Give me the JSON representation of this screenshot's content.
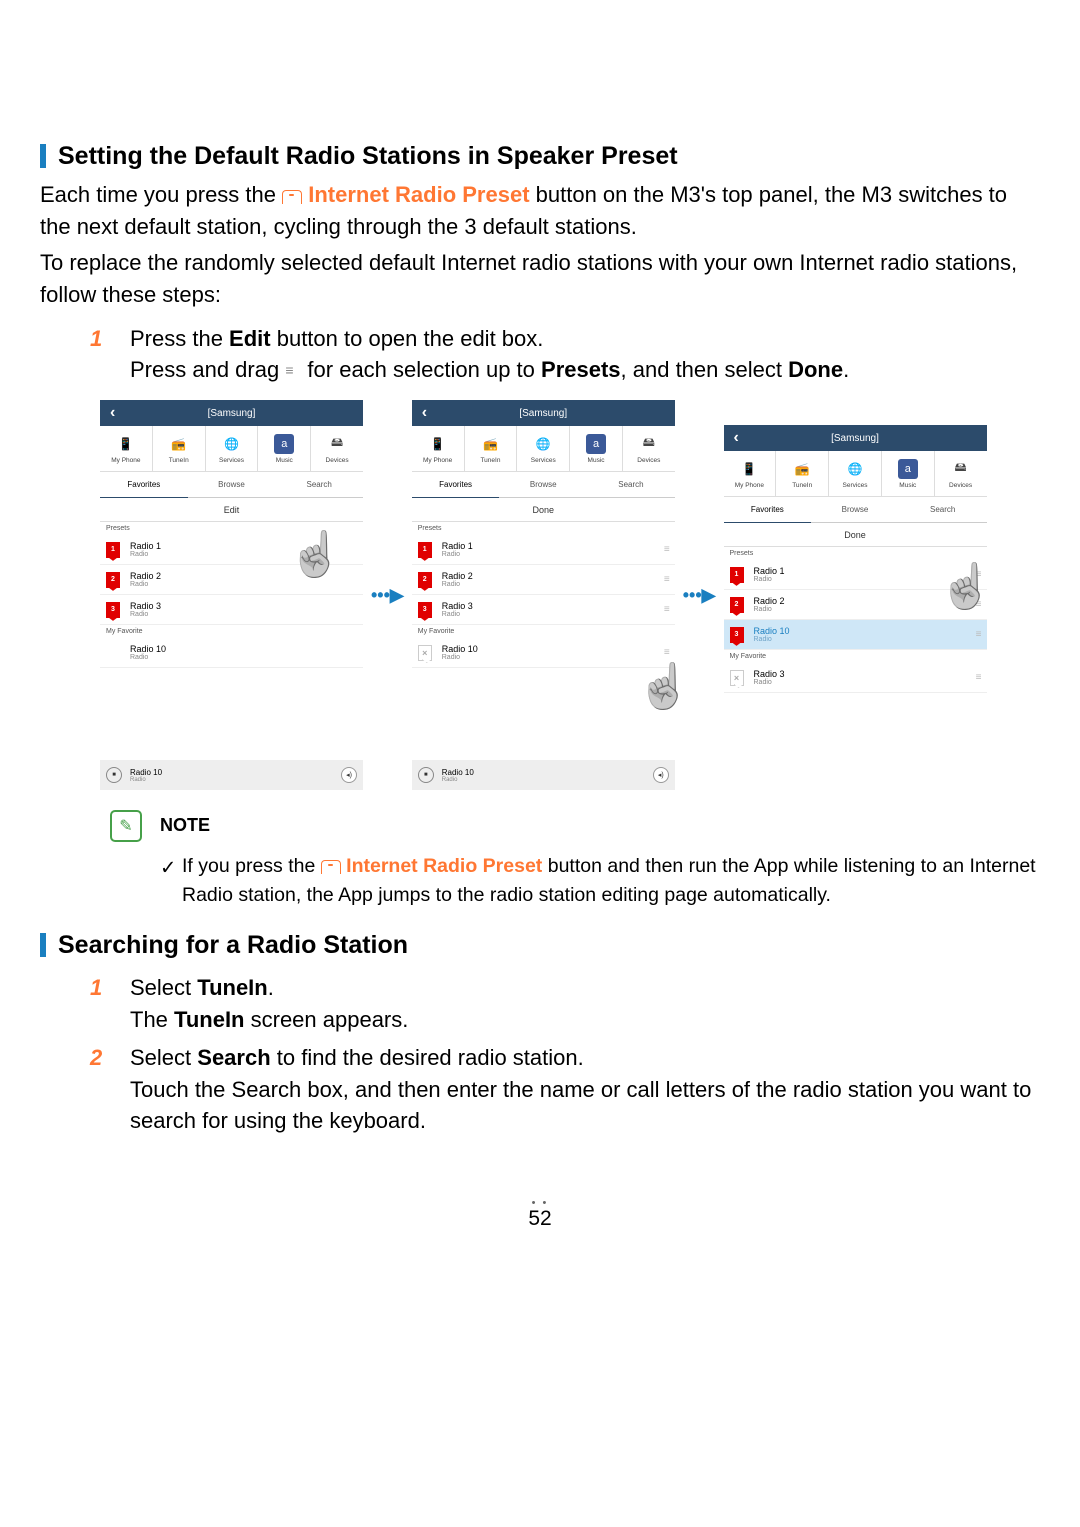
{
  "section1": {
    "title": "Setting the Default Radio Stations in Speaker Preset",
    "para1a": "Each time you press the ",
    "preset_label": " Internet Radio Preset",
    "para1b": " button on the M3's top panel, the M3 switches to the next default station, cycling through the 3 default stations.",
    "para2": "To replace the randomly selected default Internet radio stations with your own Internet radio stations, follow these steps:",
    "step1a": "Press the ",
    "step1_edit": "Edit",
    "step1b": " button to open the edit box.",
    "step1c": "Press and drag ",
    "step1d": " for each selection up to ",
    "step1_presets": "Presets",
    "step1e": ", and then select ",
    "step1_done": "Done",
    "step1f": "."
  },
  "screens": {
    "arrow": "•••▶",
    "header_title": "[Samsung]",
    "sources": {
      "phone": "My Phone",
      "tunein": "TuneIn",
      "services": "Services",
      "music": "Music",
      "devices": "Devices"
    },
    "tabs": {
      "favorites": "Favorites",
      "browse": "Browse",
      "search": "Search"
    },
    "s1": {
      "action": "Edit",
      "presets_label": "Presets",
      "myfav_label": "My Favorite",
      "radio1": "Radio 1",
      "radio2": "Radio 2",
      "radio3": "Radio 3",
      "radio10": "Radio 10",
      "sub": "Radio",
      "np_name": "Radio 10",
      "np_sub": "Radio"
    },
    "s2": {
      "action": "Done",
      "presets_label": "Presets",
      "myfav_label": "My Favorite",
      "radio1": "Radio 1",
      "radio2": "Radio 2",
      "radio3": "Radio 3",
      "radio10": "Radio 10",
      "sub": "Radio",
      "np_name": "Radio 10",
      "np_sub": "Radio"
    },
    "s3": {
      "action": "Done",
      "presets_label": "Presets",
      "myfav_label": "My Favorite",
      "radio1": "Radio 1",
      "radio2": "Radio 2",
      "radio10": "Radio 10",
      "radio3": "Radio 3",
      "sub": "Radio"
    }
  },
  "note": {
    "label": "NOTE",
    "text1": "If you press the ",
    "preset_label": " Internet Radio Preset",
    "text2": " button and then run the App while listening to an Internet Radio station, the App jumps to the radio station editing page automatically."
  },
  "section2": {
    "title": "Searching for a Radio Station",
    "step1a": "Select ",
    "step1_tunein": "TuneIn",
    "step1b": ".",
    "step1c": "The ",
    "step1d": " screen appears.",
    "step2a": "Select ",
    "step2_search": "Search",
    "step2b": " to find the desired radio station.",
    "step2c": "Touch the Search box, and then enter the name or call letters of the radio station you want to search for using the keyboard."
  },
  "page_number": "52"
}
